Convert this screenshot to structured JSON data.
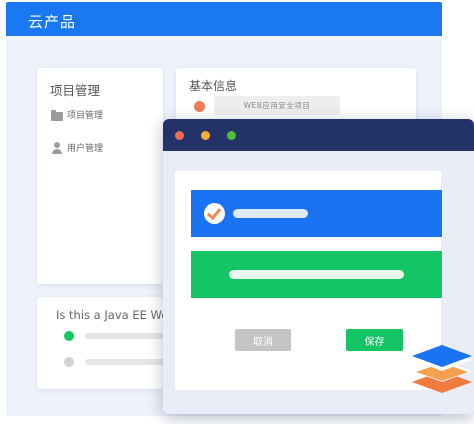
{
  "app": {
    "title": "云产品"
  },
  "project_card": {
    "title": "项目管理",
    "items": [
      {
        "label": "项目管理",
        "icon": "folder-icon"
      },
      {
        "label": "用户管理",
        "icon": "user-icon"
      }
    ]
  },
  "basic_info_card": {
    "title": "基本信息",
    "tag": "WEB应用安全项目",
    "status_color": "#f07b54"
  },
  "question_card": {
    "text": "Is this a Java EE Web",
    "options": [
      {
        "state": "selected",
        "color": "#14c566"
      },
      {
        "state": "unselected",
        "color": "#d2d2d2"
      }
    ]
  },
  "dialog": {
    "window_controls": [
      "#f26a55",
      "#f6ac2c",
      "#4fc136"
    ],
    "cancel_label": "取消",
    "save_label": "保存"
  },
  "colors": {
    "brand_blue": "#1a78f2",
    "navy": "#233269",
    "green": "#14c566",
    "accent_orange": "#f08a4b"
  }
}
